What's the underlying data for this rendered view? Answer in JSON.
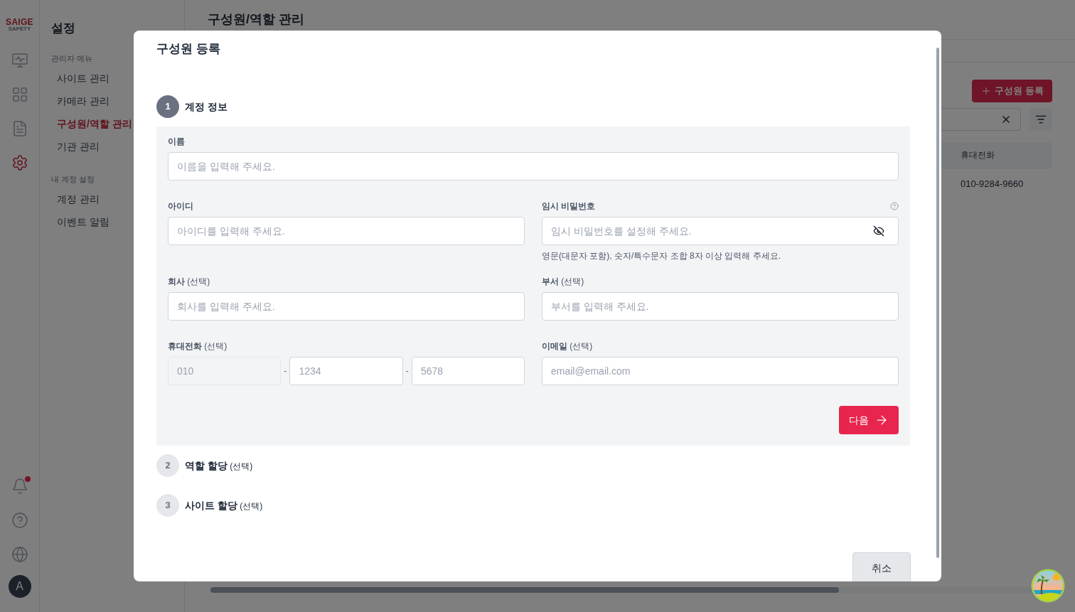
{
  "rail": {
    "logo": {
      "line1": "SAIGE",
      "line2": "SAFETY"
    },
    "items": [
      {
        "kind": "monitor",
        "selected": false
      },
      {
        "kind": "grid",
        "selected": false
      },
      {
        "kind": "document",
        "selected": false
      },
      {
        "kind": "settings",
        "selected": true
      }
    ],
    "bottom": [
      {
        "kind": "bell",
        "unread": true
      },
      {
        "kind": "help",
        "unread": false
      },
      {
        "kind": "globe",
        "unread": false
      }
    ],
    "avatar": "A"
  },
  "sidebar": {
    "title": "설정",
    "sections": [
      {
        "heading": "관리자 메뉴",
        "items": [
          {
            "label": "사이트 관리",
            "selected": false
          },
          {
            "label": "카메라 관리",
            "selected": false
          },
          {
            "label": "구성원/역할 관리",
            "selected": true
          },
          {
            "label": "기관 관리",
            "selected": false
          }
        ]
      },
      {
        "heading": "내 계정 설정",
        "items": [
          {
            "label": "계정 관리",
            "selected": false
          },
          {
            "label": "이벤트 알림",
            "selected": false
          }
        ]
      }
    ]
  },
  "main": {
    "title": "구성원/역할 관리",
    "add_button": "구성원 등록",
    "table": {
      "columns": [
        "휴대전화"
      ],
      "rows": [
        {
          "phone": "010-9284-9660"
        }
      ]
    }
  },
  "modal": {
    "title": "구성원 등록",
    "steps": [
      {
        "number": "1",
        "title": "계정 정보",
        "expanded": true
      },
      {
        "number": "2",
        "title": "역할 할당",
        "note": "(선택)",
        "expanded": false
      },
      {
        "number": "3",
        "title": "사이트 할당",
        "note": "(선택)",
        "expanded": false
      }
    ],
    "form_rows": [
      [
        {
          "kind": "text",
          "label": "이름",
          "placeholder": "이름을 입력해 주세요."
        }
      ],
      [
        {
          "kind": "text",
          "label": "아이디",
          "placeholder": "아이디를 입력해 주세요."
        },
        {
          "kind": "password",
          "label": "임시 비밀번호",
          "placeholder": "임시 비밀번호를 설정해 주세요.",
          "hint": "영문(대문자 포함), 숫자/특수문자 조합 8자 이상 입력해 주세요."
        }
      ],
      [
        {
          "kind": "text",
          "label": "회사",
          "note": "(선택)",
          "placeholder": "회사를 입력해 주세요."
        },
        {
          "kind": "text",
          "label": "부서",
          "note": "(선택)",
          "placeholder": "부서를 입력해 주세요."
        }
      ],
      [
        {
          "kind": "phone",
          "label": "휴대전화",
          "note": "(선택)",
          "parts": [
            {
              "placeholder": "010",
              "disabled": true
            },
            {
              "placeholder": "1234",
              "disabled": false
            },
            {
              "placeholder": "5678",
              "disabled": false
            }
          ],
          "separators": [
            "-",
            "-"
          ]
        },
        {
          "kind": "text",
          "label": "이메일",
          "note": "(선택)",
          "placeholder": "email@email.com"
        }
      ]
    ],
    "next_button": "다음",
    "cancel_button": "취소"
  }
}
